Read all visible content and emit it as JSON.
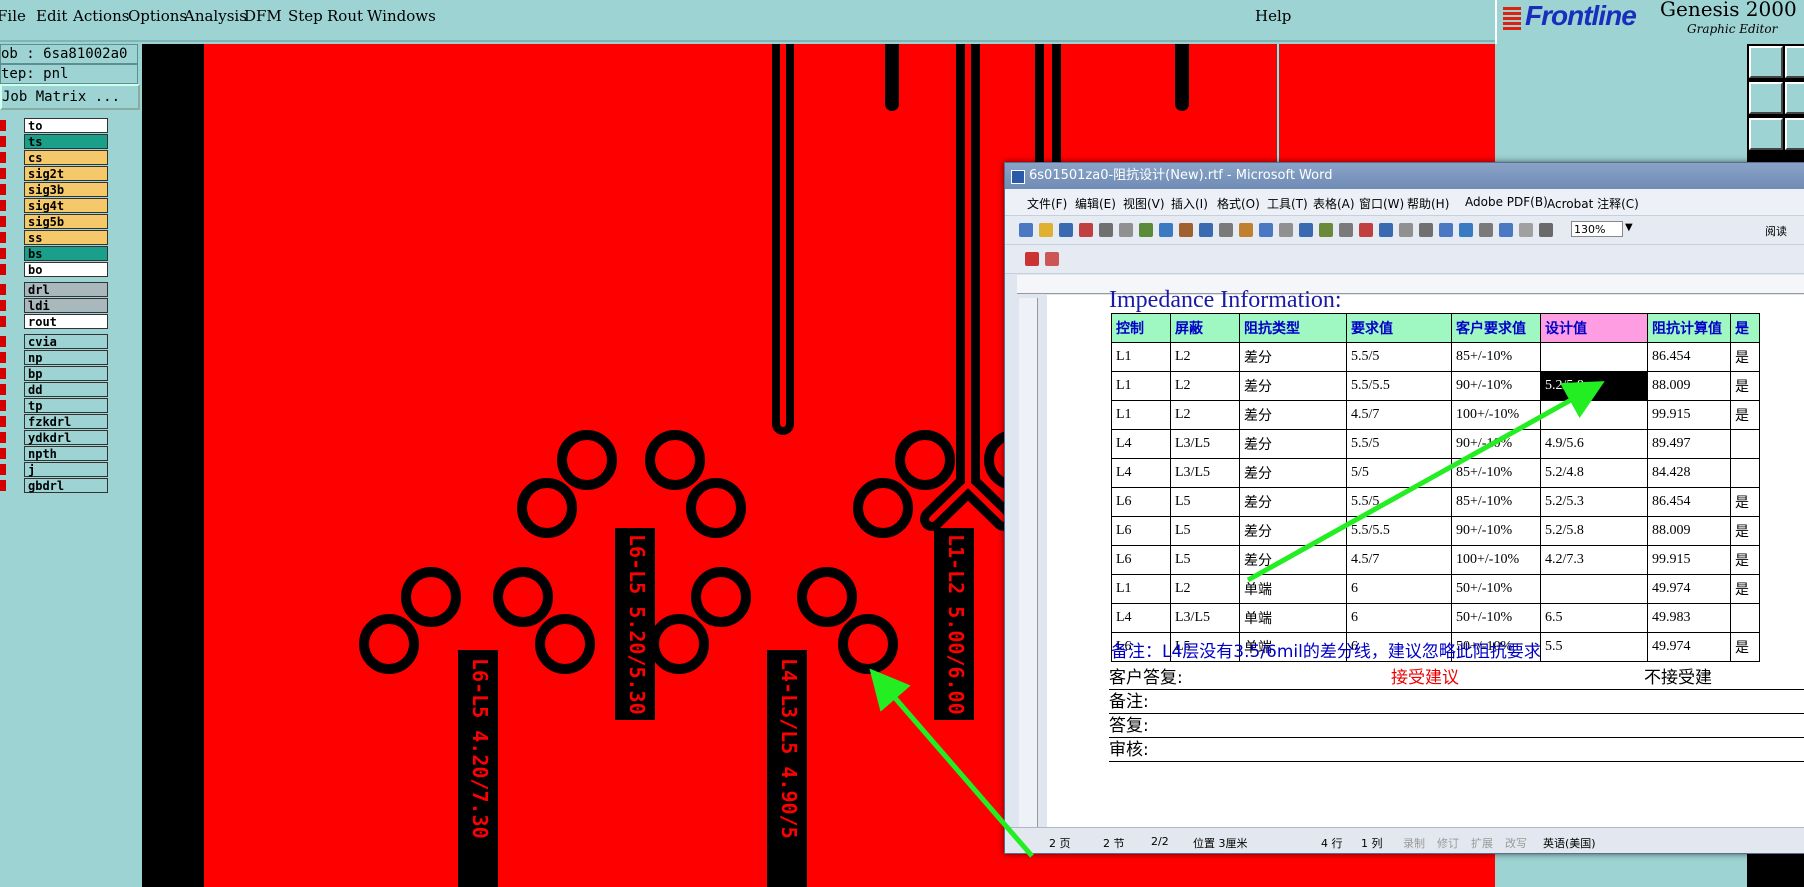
{
  "menubar": {
    "items": [
      "File",
      "Edit",
      "Actions",
      "Options",
      "Analysis",
      "DFM",
      "Step",
      "Rout",
      "Windows"
    ],
    "help": "Help"
  },
  "logo": {
    "brand": "Frontline",
    "product": "Genesis 2000",
    "subtitle": "Graphic Editor"
  },
  "leftpanel": {
    "job": "ob : 6sa81002a0",
    "step": "tep: pnl",
    "job_matrix": "Job Matrix ...",
    "layers": [
      {
        "name": "to",
        "color": "#ffffff"
      },
      {
        "name": "ts",
        "color": "#1aa08a"
      },
      {
        "name": "cs",
        "color": "#f5c86a"
      },
      {
        "name": "sig2t",
        "color": "#f5c86a"
      },
      {
        "name": "sig3b",
        "color": "#f5c86a"
      },
      {
        "name": "sig4t",
        "color": "#f5c86a"
      },
      {
        "name": "sig5b",
        "color": "#f5c86a"
      },
      {
        "name": "ss",
        "color": "#f5c86a"
      },
      {
        "name": "bs",
        "color": "#1aa08a"
      },
      {
        "name": "bo",
        "color": "#ffffff"
      },
      {
        "name": "drl",
        "color": "#a9b8bd"
      },
      {
        "name": "ldi",
        "color": "#a9b8bd"
      },
      {
        "name": "rout",
        "color": "#ffffff"
      },
      {
        "name": "cvia",
        "color": "#9ed3d3"
      },
      {
        "name": "np",
        "color": "#9ed3d3"
      },
      {
        "name": "bp",
        "color": "#9ed3d3"
      },
      {
        "name": "dd",
        "color": "#9ed3d3"
      },
      {
        "name": "tp",
        "color": "#9ed3d3"
      },
      {
        "name": "fzkdrl",
        "color": "#9ed3d3"
      },
      {
        "name": "ydkdrl",
        "color": "#9ed3d3"
      },
      {
        "name": "npth",
        "color": "#9ed3d3"
      },
      {
        "name": "j",
        "color": "#9ed3d3"
      },
      {
        "name": "gbdrl",
        "color": "#9ed3d3"
      }
    ]
  },
  "pcb_labels": [
    "L6-L5 5.20/5.30 $",
    "L1-L2 5.00/6.00 $",
    "L6-L5 4.20/7.30",
    "L4-L3/L5 4.90/5"
  ],
  "word": {
    "title": "6s01501za0-阻抗设计(New).rtf - Microsoft Word",
    "menu": [
      "文件(F)",
      "编辑(E)",
      "视图(V)",
      "插入(I)",
      "格式(O)",
      "工具(T)",
      "表格(A)",
      "窗口(W)",
      "帮助(H)",
      "Adobe PDF(B)",
      "Acrobat 注释(C)"
    ],
    "zoom": "130%",
    "read_btn": "阅读",
    "heading": "Impedance Information:",
    "table_headers": [
      "控制",
      "屏蔽",
      "阻抗类型",
      "要求值",
      "客户要求值",
      "设计值",
      "阻抗计算值",
      "是"
    ],
    "table_rows": [
      [
        "L1",
        "L2",
        "差分",
        "5.5/5",
        "85+/-10%",
        "",
        "86.454",
        "是"
      ],
      [
        "L1",
        "L2",
        "差分",
        "5.5/5.5",
        "90+/-10%",
        "5.2/5.8",
        "88.009",
        "是"
      ],
      [
        "L1",
        "L2",
        "差分",
        "4.5/7",
        "100+/-10%",
        "",
        "99.915",
        "是"
      ],
      [
        "L4",
        "L3/L5",
        "差分",
        "5.5/5",
        "90+/-10%",
        "4.9/5.6",
        "89.497",
        ""
      ],
      [
        "L4",
        "L3/L5",
        "差分",
        "5/5",
        "85+/-10%",
        "5.2/4.8",
        "84.428",
        ""
      ],
      [
        "L6",
        "L5",
        "差分",
        "5.5/5",
        "85+/-10%",
        "5.2/5.3",
        "86.454",
        "是"
      ],
      [
        "L6",
        "L5",
        "差分",
        "5.5/5.5",
        "90+/-10%",
        "5.2/5.8",
        "88.009",
        "是"
      ],
      [
        "L6",
        "L5",
        "差分",
        "4.5/7",
        "100+/-10%",
        "4.2/7.3",
        "99.915",
        "是"
      ],
      [
        "L1",
        "L2",
        "单端",
        "6",
        "50+/-10%",
        "",
        "49.974",
        "是"
      ],
      [
        "L4",
        "L3/L5",
        "单端",
        "6",
        "50+/-10%",
        "6.5",
        "49.983",
        ""
      ],
      [
        "L6",
        "L5",
        "单端",
        "6",
        "50+/-10%",
        "5.5",
        "49.974",
        "是"
      ]
    ],
    "note": "备注：L4层没有3.5/6mil的差分线，建议忽略此阻抗要求",
    "reply_label": "客户答复:",
    "accept": "接受建议",
    "reject": "不接受建",
    "remark_label": "备注:",
    "answer_label": "答复:",
    "review_label": "审核:",
    "status": {
      "page": "2 页",
      "section": "2 节",
      "pages": "2/2",
      "position": "位置 3厘米",
      "line": "4 行",
      "col": "1 列",
      "rec": "录制",
      "trk": "修订",
      "ext": "扩展",
      "ovr": "改写",
      "lang": "英语(美国)"
    },
    "accent_pink": "#ff9de3",
    "accent_green": "#9ff7c2"
  }
}
